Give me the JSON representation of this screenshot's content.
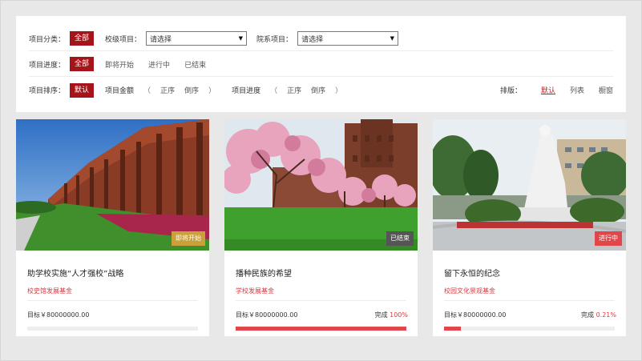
{
  "filters": {
    "category": {
      "label": "项目分类：",
      "all": "全部",
      "school_label": "校级项目：",
      "school_value": "请选择",
      "dept_label": "院系项目：",
      "dept_value": "请选择"
    },
    "progress": {
      "label": "项目进度：",
      "all": "全部",
      "options": [
        "即将开始",
        "进行中",
        "已结束"
      ]
    },
    "sort": {
      "label": "项目排序：",
      "default": "默认",
      "amount_label": "项目金额",
      "progress_label": "项目进度",
      "asc": "正序",
      "desc": "倒序",
      "open_paren": "（",
      "close_paren": "）"
    },
    "layout": {
      "label": "排版：",
      "options": [
        "默认",
        "列表",
        "橱窗"
      ],
      "active": "默认"
    }
  },
  "cards": [
    {
      "title": "助学校实施“人才强校”战略",
      "fund": "校史馆发展基金",
      "goal": "目标￥80000000.00",
      "status": "即将开始",
      "status_color": "#c9a03a",
      "done_label": "",
      "percent_text": "",
      "progress": 0
    },
    {
      "title": "播种民族的希望",
      "fund": "学校发展基金",
      "goal": "目标￥80000000.00",
      "status": "已结束",
      "status_color": "#555555",
      "done_label": "完成",
      "percent_text": "100%",
      "progress": 1
    },
    {
      "title": "留下永恒的纪念",
      "fund": "校园文化景观基金",
      "goal": "目标￥80000000.00",
      "status": "进行中",
      "status_color": "#e0464a",
      "done_label": "完成",
      "percent_text": "0.21%",
      "progress": 0.1
    }
  ]
}
